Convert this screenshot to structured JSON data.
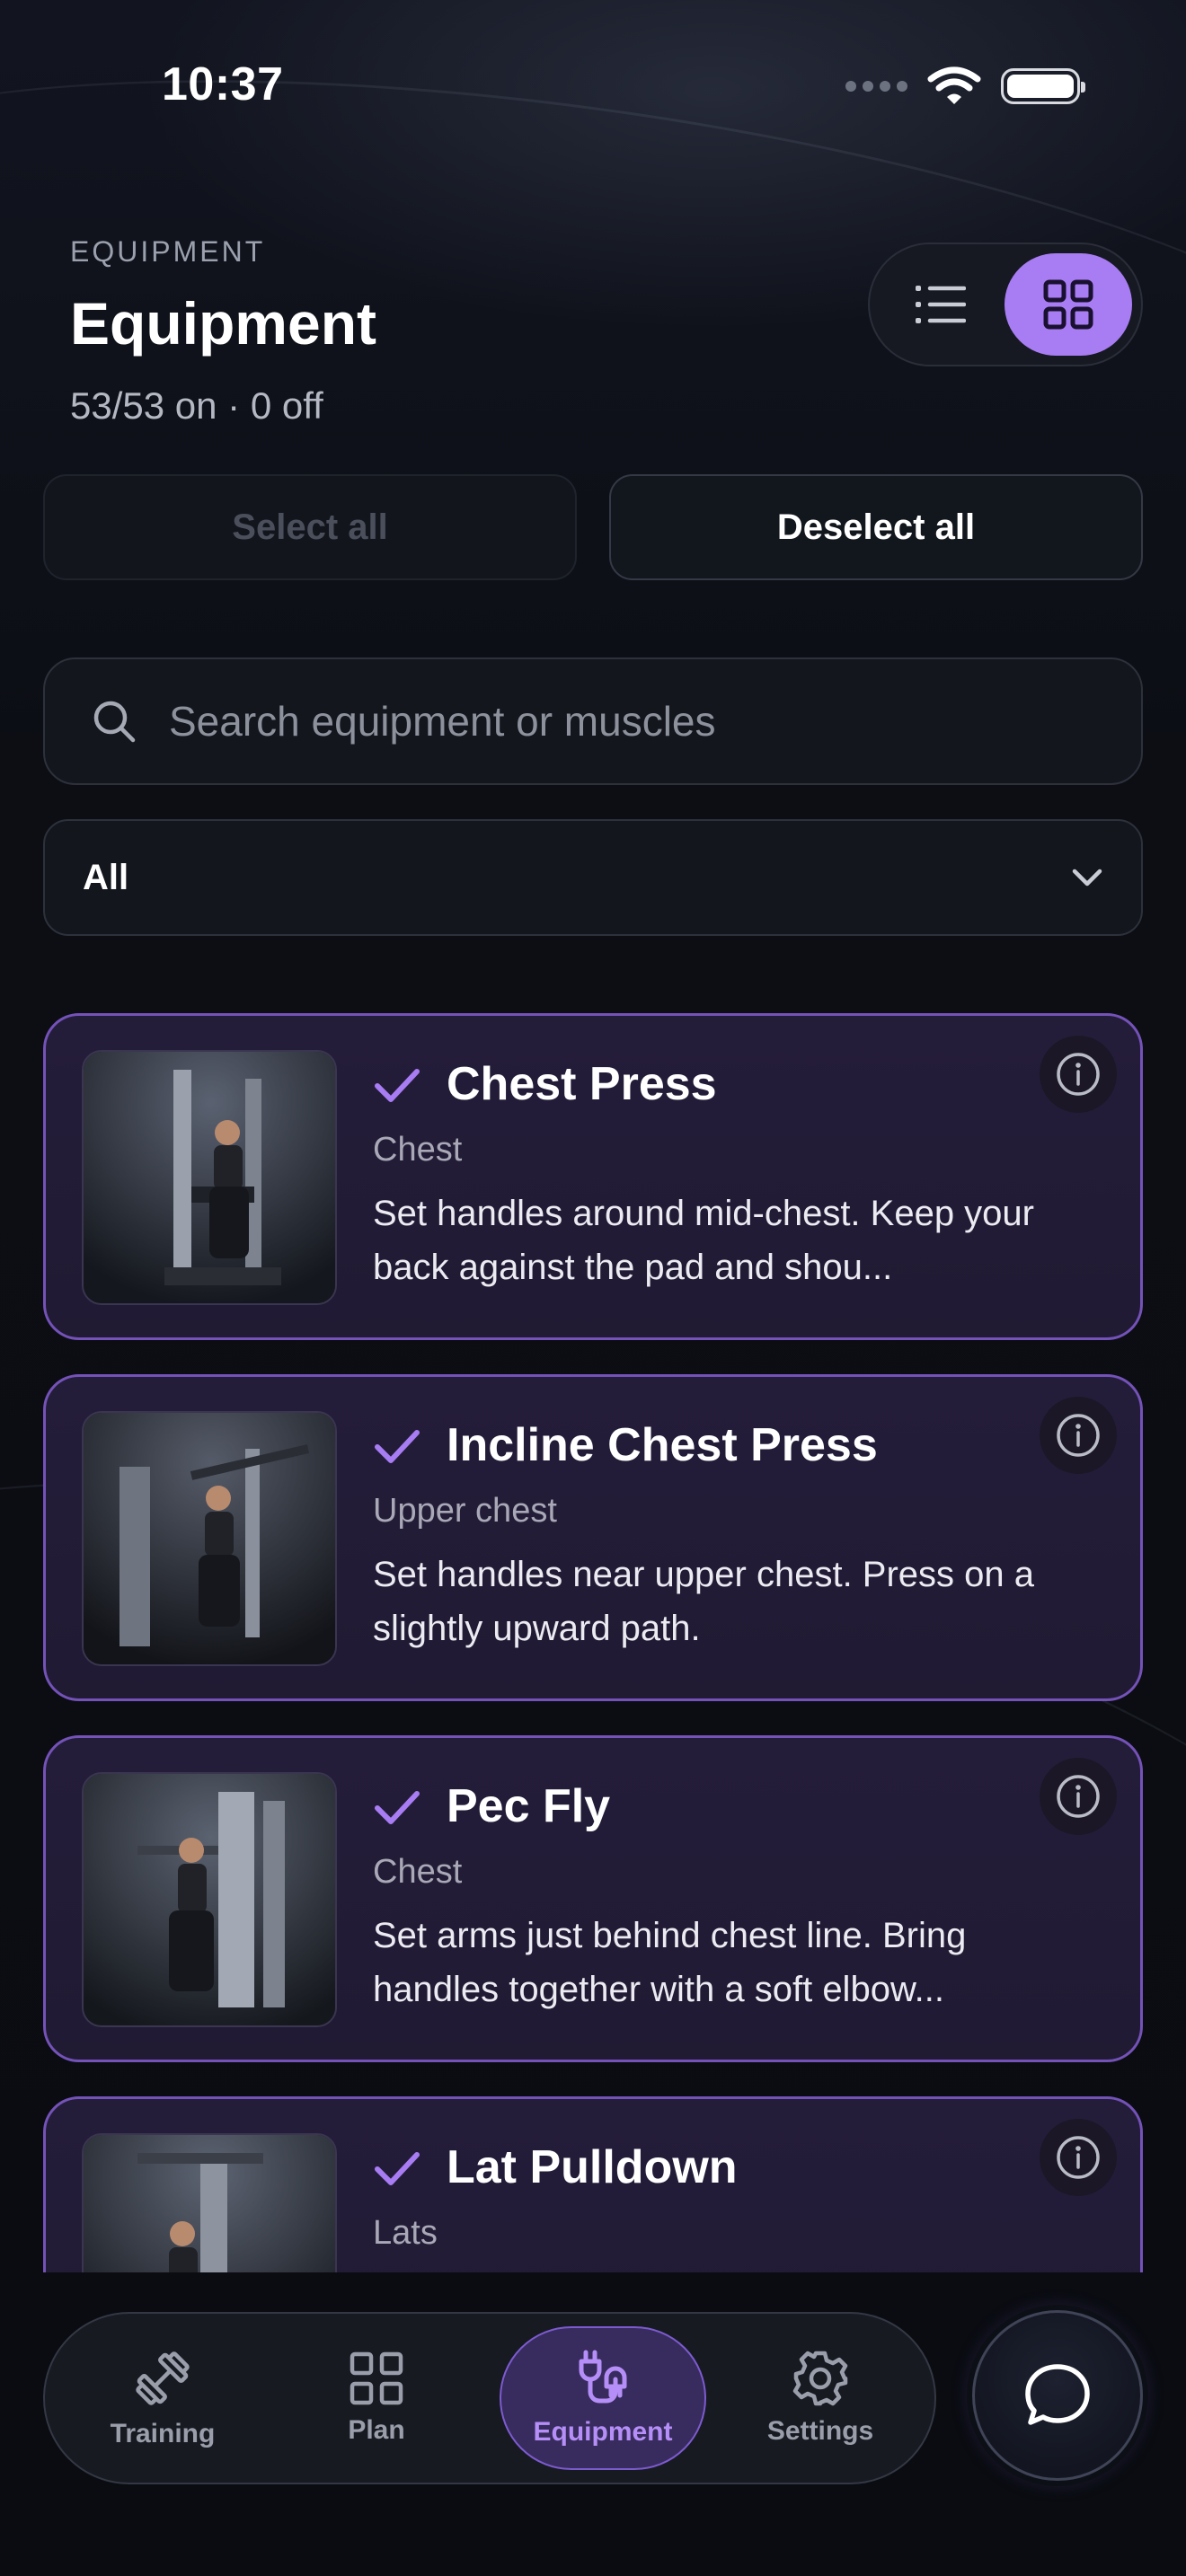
{
  "status_bar": {
    "time": "10:37"
  },
  "header": {
    "eyebrow": "EQUIPMENT",
    "title": "Equipment",
    "subtitle": "53/53 on · 0 off"
  },
  "view_toggle": {
    "selected": "grid"
  },
  "actions": {
    "select_all": "Select all",
    "deselect_all": "Deselect all"
  },
  "search": {
    "placeholder": "Search equipment or muscles",
    "value": ""
  },
  "filter": {
    "selected": "All"
  },
  "equipment": [
    {
      "name": "Chest Press",
      "muscle": "Chest",
      "description": "Set handles around mid-chest. Keep your back against the pad and shou...",
      "enabled": true
    },
    {
      "name": "Incline Chest Press",
      "muscle": "Upper chest",
      "description": "Set handles near upper chest. Press on a slightly upward path.",
      "enabled": true
    },
    {
      "name": "Pec Fly",
      "muscle": "Chest",
      "description": "Set arms just behind chest line. Bring handles together with a soft elbow...",
      "enabled": true
    },
    {
      "name": "Lat Pulldown",
      "muscle": "Lats",
      "description": "",
      "enabled": true
    }
  ],
  "nav": {
    "items": [
      {
        "label": "Training",
        "icon": "dumbbell-icon"
      },
      {
        "label": "Plan",
        "icon": "grid-icon"
      },
      {
        "label": "Equipment",
        "icon": "plug-icon",
        "active": true
      },
      {
        "label": "Settings",
        "icon": "gear-icon"
      }
    ]
  },
  "colors": {
    "accent": "#a87cf3",
    "card_bg": "#231c38",
    "card_border": "#7452b8"
  }
}
